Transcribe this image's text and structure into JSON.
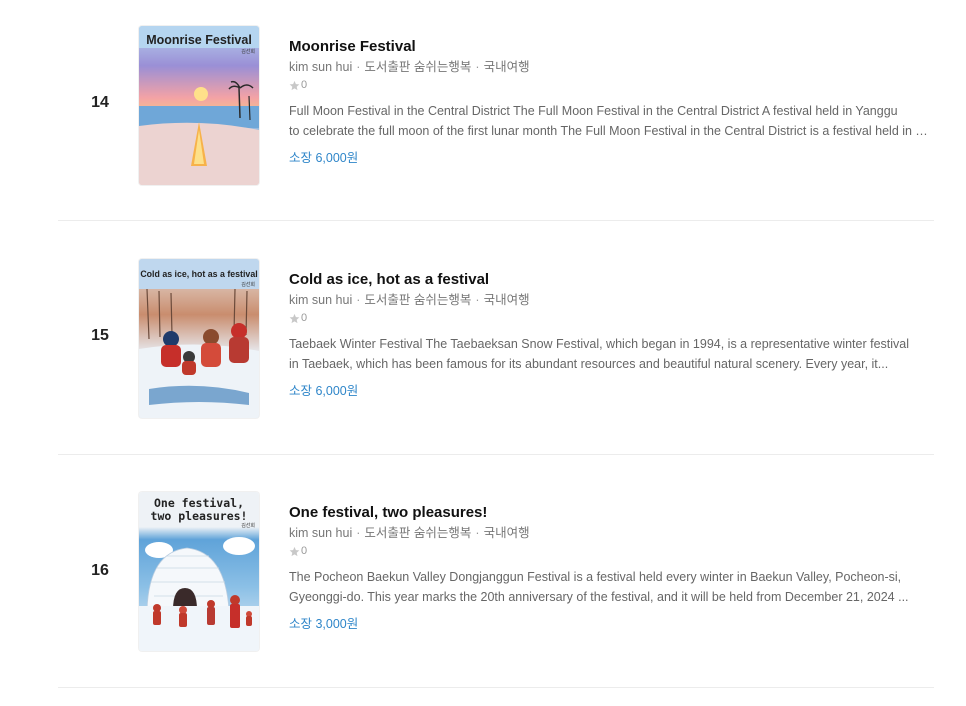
{
  "items": [
    {
      "rank": "14",
      "title": "Moonrise Festival",
      "author": "kim sun hui",
      "publisher": "도서출판 숨쉬는행복",
      "category": "국내여행",
      "rating": "0",
      "desc_line1": "Full Moon Festival in the Central District The Full Moon Festival in the Central District A festival held in Yanggu",
      "desc_line2": "to celebrate the full moon of the first lunar month The Full Moon Festival in the Central District is a festival held in Yanggu...",
      "price": "소장 6,000원",
      "cover_title": "Moonrise Festival",
      "cover_author": "김선희"
    },
    {
      "rank": "15",
      "title": "Cold as ice, hot as a festival",
      "author": "kim sun hui",
      "publisher": "도서출판 숨쉬는행복",
      "category": "국내여행",
      "rating": "0",
      "desc_line1": "Taebaek Winter Festival The Taebaeksan Snow Festival, which began in 1994, is a representative winter festival",
      "desc_line2": "in Taebaek, which has been famous for its abundant resources and beautiful natural scenery. Every year, it...",
      "price": "소장 6,000원",
      "cover_title": "Cold as ice, hot as a festival",
      "cover_author": "김선희"
    },
    {
      "rank": "16",
      "title": "One festival, two pleasures!",
      "author": "kim sun hui",
      "publisher": "도서출판 숨쉬는행복",
      "category": "국내여행",
      "rating": "0",
      "desc_line1": "The Pocheon Baekun Valley Dongjanggun Festival is a festival held every winter in Baekun Valley, Pocheon-si,",
      "desc_line2": "Gyeonggi-do. This year marks the 20th anniversary of the festival, and it will be held from December 21, 2024 ...",
      "price": "소장 3,000원",
      "cover_title_line1": "One festival,",
      "cover_title_line2": "two pleasures!",
      "cover_author": "김선희"
    }
  ],
  "icons": {
    "rating": "star-icon"
  },
  "colors": {
    "price": "#2f86c9",
    "divider": "#ececec",
    "meta": "#777777"
  }
}
